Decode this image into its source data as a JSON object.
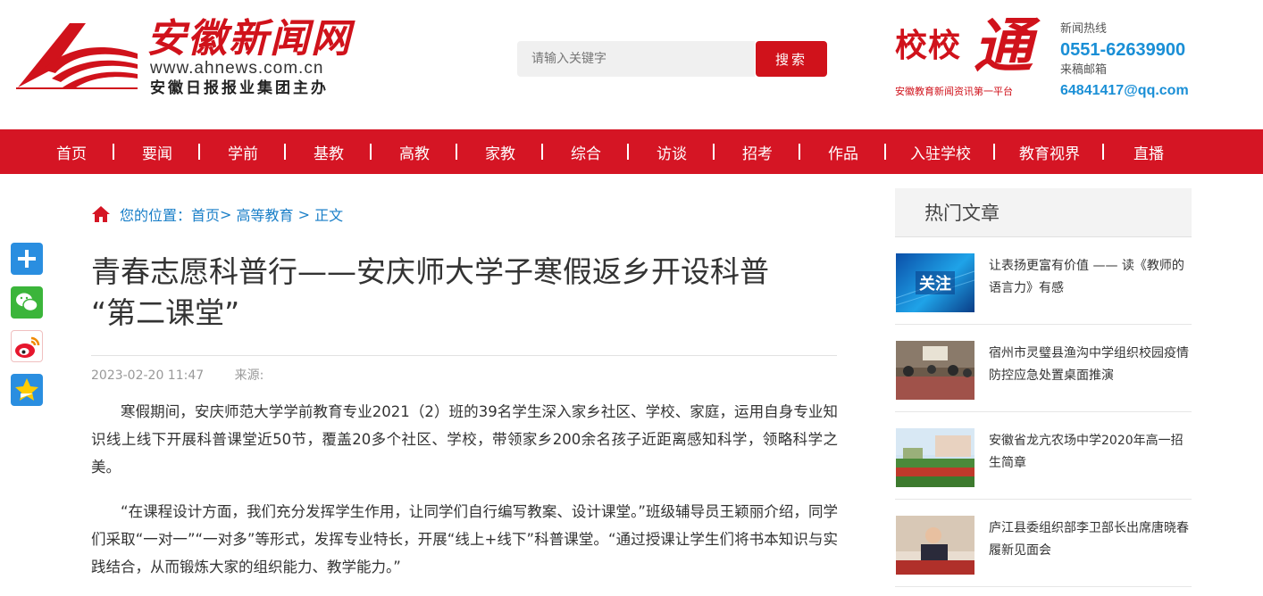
{
  "site": {
    "name": "安徽新闻网",
    "url": "www.ahnews.com.cn",
    "owner": "安徽日报报业集团主办"
  },
  "search": {
    "placeholder": "请输入关键字",
    "button": "搜索"
  },
  "partner": {
    "name_part1": "校校",
    "name_part2": "通",
    "tagline": "安徽教育新闻资讯第一平台"
  },
  "contact": {
    "hotline_label": "新闻热线",
    "hotline": "0551-62639900",
    "email_label": "来稿邮箱",
    "email": "64841417@qq.com"
  },
  "nav": [
    {
      "label": "首页"
    },
    {
      "label": "要闻"
    },
    {
      "label": "学前"
    },
    {
      "label": "基教"
    },
    {
      "label": "高教"
    },
    {
      "label": "家教"
    },
    {
      "label": "综合"
    },
    {
      "label": "访谈"
    },
    {
      "label": "招考"
    },
    {
      "label": "作品"
    },
    {
      "label": "入驻学校"
    },
    {
      "label": "教育视界"
    },
    {
      "label": "直播"
    }
  ],
  "breadcrumb": {
    "prefix": "您的位置：",
    "home": "首页",
    "sep1": "> ",
    "section": "高等教育",
    "sep2": " > ",
    "current": "正文"
  },
  "article": {
    "title_line1": "青春志愿科普行——安庆师大学子寒假返乡开设科普",
    "title_line2": "“第二课堂”",
    "date": "2023-02-20 11:47",
    "source_label": "来源:",
    "paragraphs": [
      "寒假期间，安庆师范大学学前教育专业2021（2）班的39名学生深入家乡社区、学校、家庭，运用自身专业知识线上线下开展科普课堂近50节，覆盖20多个社区、学校，带领家乡200余名孩子近距离感知科学，领略科学之美。",
      "“在课程设计方面，我们充分发挥学生作用，让同学们自行编写教案、设计课堂。”班级辅导员王颖丽介绍，同学们采取“一对一”“一对多”等形式，发挥专业特长，开展“线上+线下”科普课堂。“通过授课让学生们将书本知识与实践结合，从而锻炼大家的组织能力、教学能力。”"
    ]
  },
  "share_icons": [
    "plus-share-icon",
    "wechat-icon",
    "weibo-icon",
    "qzone-icon"
  ],
  "sidebar": {
    "heading": "热门文章",
    "items": [
      {
        "thumb_text": "关注",
        "title": "让表扬更富有价值 —— 读《教师的语言力》有感"
      },
      {
        "title": "宿州市灵璧县渔沟中学组织校园疫情防控应急处置桌面推演"
      },
      {
        "title": "安徽省龙亢农场中学2020年高一招生简章"
      },
      {
        "title": "庐江县委组织部李卫部长出席唐晓春履新见面会"
      }
    ]
  },
  "colors": {
    "brand_red": "#d51524",
    "link_blue": "#1a7fc8",
    "contact_blue": "#1a8fd6"
  }
}
